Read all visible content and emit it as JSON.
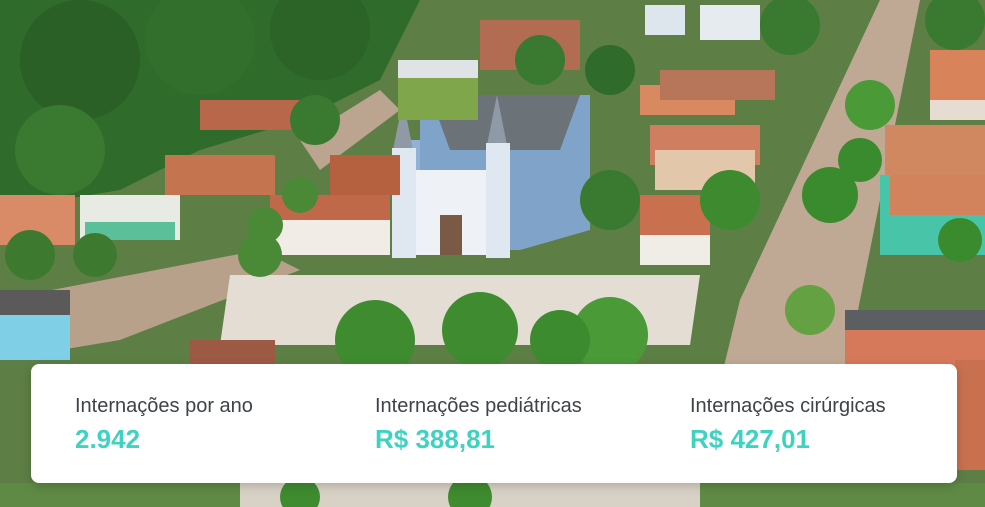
{
  "photo": {
    "subject": "aerial-town-church-square",
    "colors": {
      "trees": "#2f6b2a",
      "road": "#bfa994",
      "roof": "#c0694a",
      "church": "#8fb2d6",
      "plaza": "#e3ddd3"
    }
  },
  "stats": {
    "items": [
      {
        "label": "Internações por ano",
        "value": "2.942"
      },
      {
        "label": "Internações pediátricas",
        "value": "R$ 388,81"
      },
      {
        "label": "Internações cirúrgicas",
        "value": "R$ 427,01"
      }
    ],
    "value_color": "#3ed3c1"
  }
}
